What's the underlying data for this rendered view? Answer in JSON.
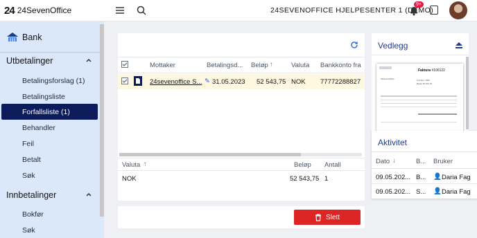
{
  "app": {
    "logo_mark": "24",
    "logo_text": "24SevenOffice",
    "center_title": "24SEVENOFFICE HJELPESENTER 1 (DEMO)",
    "notification_count": "9+"
  },
  "sidebar": {
    "bank_label": "Bank",
    "sections": [
      {
        "label": "Utbetalinger",
        "items": [
          "Betalingsforslag (1)",
          "Betalingsliste",
          "Forfallsliste (1)",
          "Behandler",
          "Feil",
          "Betalt",
          "Søk"
        ]
      },
      {
        "label": "Innbetalinger",
        "items": [
          "Bokfør",
          "Søk"
        ]
      }
    ]
  },
  "payments": {
    "headers": {
      "recipient": "Mottaker",
      "date": "Betalingsd...",
      "amount": "Beløp",
      "currency": "Valuta",
      "account": "Bankkonto fra"
    },
    "row": {
      "recipient": "24sevenoffice S...",
      "date": "31.05.2023",
      "amount": "52 543,75",
      "currency": "NOK",
      "account": "77772288827"
    }
  },
  "summary": {
    "headers": {
      "currency": "Valuta",
      "amount": "Beløp",
      "count": "Antall"
    },
    "row": {
      "currency": "NOK",
      "amount": "52 543,75",
      "count": "1"
    }
  },
  "actions": {
    "delete_label": "Slett"
  },
  "attachments": {
    "title": "Vedlegg",
    "doc": {
      "label": "Faktura",
      "number": "#100122",
      "lines": [
        {
          "left": "24SevenOffice",
          "right": ""
        },
        {
          "left": "Kundenr",
          "right": "1000"
        },
        {
          "left": "Beløp",
          "right": "52 543,75"
        }
      ]
    }
  },
  "activity": {
    "title": "Aktivitet",
    "headers": {
      "date": "Dato",
      "type": "B...",
      "user": "Bruker"
    },
    "rows": [
      {
        "date": "09.05.202...",
        "type": "B...",
        "user": "Daria Fag"
      },
      {
        "date": "09.05.202...",
        "type": "S...",
        "user": "Daria Fag"
      }
    ]
  },
  "colors": {
    "accent": "#0c1c5a",
    "sidebar_bg": "#dbe8fb",
    "danger": "#dc2626",
    "selected_row": "#fff8e1"
  }
}
